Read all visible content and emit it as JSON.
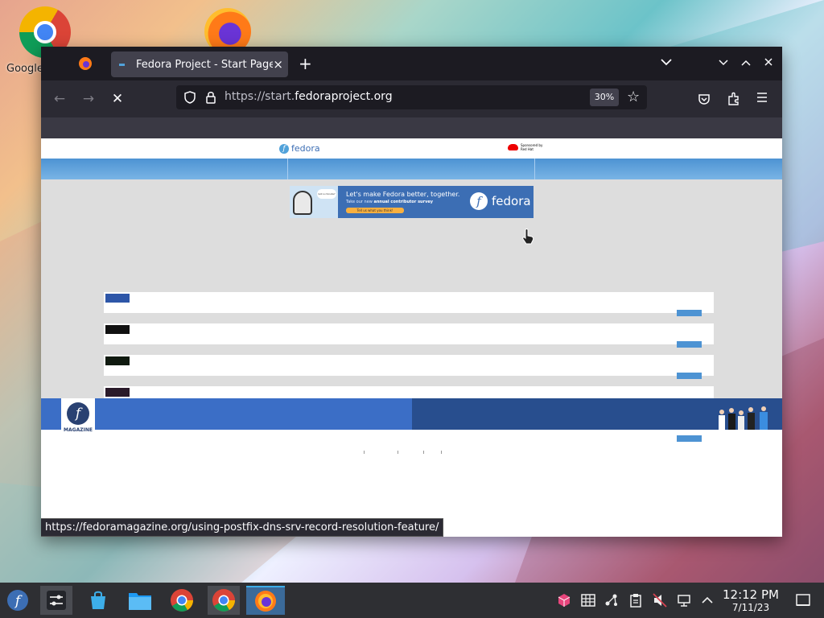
{
  "desktop": {
    "icons": [
      {
        "label": "Google"
      },
      {
        "label": ""
      }
    ]
  },
  "browser": {
    "tab": {
      "title": "Fedora Project - Start Page",
      "close": "×"
    },
    "new_tab": "+",
    "window_controls": {
      "list_all_tabs": "⌄",
      "minimize": "⌄",
      "maximize": "⌃",
      "close": "✕"
    },
    "nav": {
      "back": "←",
      "forward": "→",
      "stop": "✕"
    },
    "url": {
      "prefix": "https://start.",
      "domain": "fedoraproject.org"
    },
    "zoom": "30%",
    "status_url": "https://fedoramagazine.org/using-postfix-dns-srv-record-resolution-feature/"
  },
  "page": {
    "fedora_logo": "fedora",
    "sponsor": {
      "line1": "Sponsored by",
      "line2": "Red Hat"
    },
    "banner": {
      "bubble": "Got a minute?",
      "headline": "Let's make Fedora better, together.",
      "sub_pre": "Take our new ",
      "sub_bold": "annual contributor survey",
      "button": "Tell us what you think!",
      "brand": "fedora"
    },
    "articles": [
      {
        "thumb_color": "#2d56a8"
      },
      {
        "thumb_color": "#111111"
      },
      {
        "thumb_color": "#101a10"
      },
      {
        "thumb_color": "#2a1a2a"
      },
      {
        "thumb_color": "#9a9a9a"
      }
    ],
    "magazine_label": "MAGAZINE"
  },
  "taskbar": {
    "clock": {
      "time": "12:12 PM",
      "date": "7/11/23"
    }
  },
  "colors": {
    "fedora_blue": "#3c6eb4",
    "link_blue": "#4d93d3",
    "firefox_dark": "#1c1b22",
    "kde_accent": "#3daee9"
  }
}
